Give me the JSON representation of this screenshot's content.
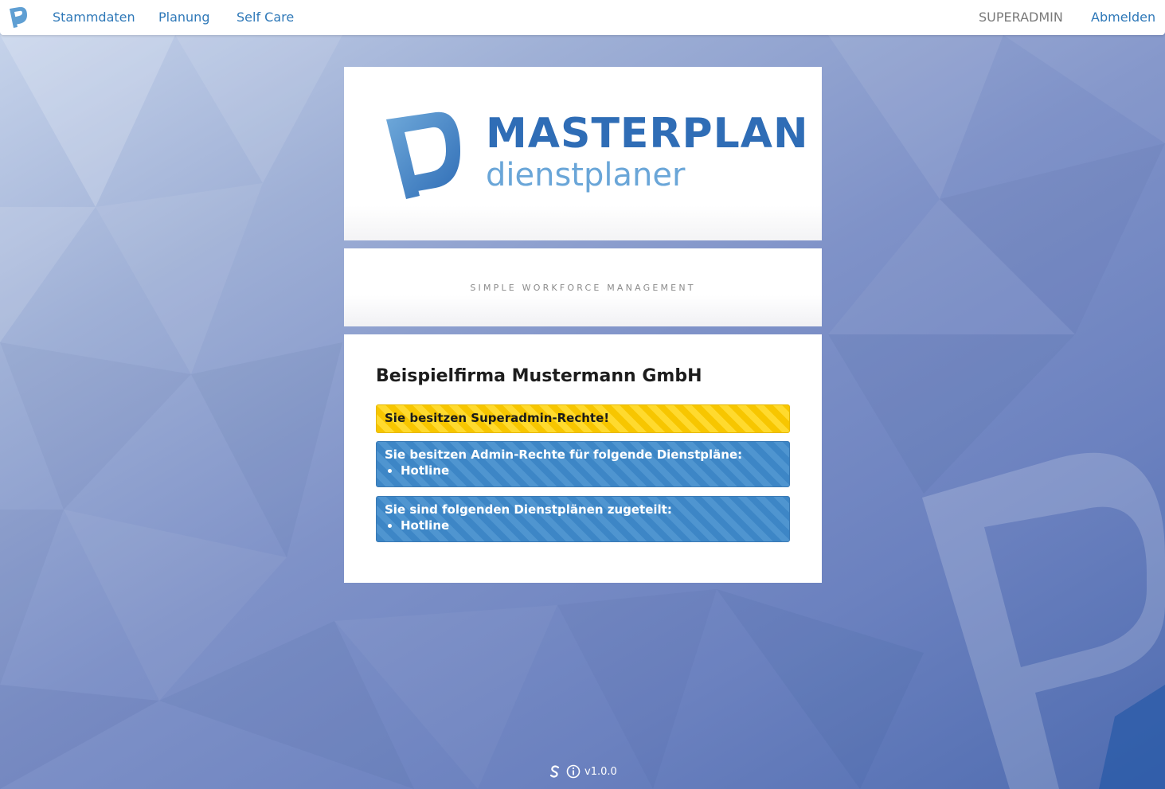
{
  "navbar": {
    "items": [
      {
        "label": "Stammdaten"
      },
      {
        "label": "Planung"
      },
      {
        "label": "Self Care"
      }
    ],
    "user": "SUPERADMIN",
    "logout": "Abmelden"
  },
  "brand": {
    "name": "MASTERPLAN",
    "sub": "dienstplaner",
    "tagline": "SIMPLE WORKFORCE MANAGEMENT"
  },
  "info": {
    "company": "Beispielfirma Mustermann GmbH",
    "superadmin_alert": "Sie besitzen Superadmin-Rechte!",
    "admin_alert": {
      "title": "Sie besitzen Admin-Rechte für folgende Dienstpläne:",
      "items": [
        "Hotline"
      ]
    },
    "assigned_alert": {
      "title": "Sie sind folgenden Dienstplänen zugeteilt:",
      "items": [
        "Hotline"
      ]
    }
  },
  "footer": {
    "version": "v1.0.0"
  },
  "icons": {
    "nav_logo": "masterplan-logo-icon",
    "footer_left": "s-brand-icon",
    "footer_info": "info-icon"
  },
  "colors": {
    "link": "#2e78b8",
    "warning": "#f7c600",
    "info": "#3d86c6",
    "brand_dark": "#2f6db6",
    "brand_light": "#5f9fd3"
  }
}
